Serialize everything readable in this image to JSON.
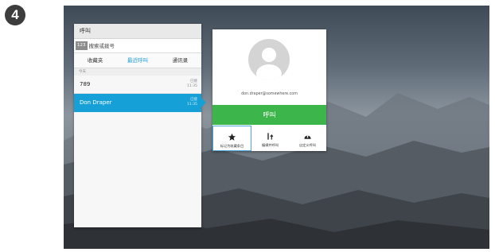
{
  "step": {
    "number": "4"
  },
  "call_panel": {
    "title": "呼叫",
    "keypad_label": "123",
    "search_placeholder": "搜索或拨号",
    "tabs": [
      {
        "label": "收藏夹"
      },
      {
        "label": "最近呼叫",
        "active": true
      },
      {
        "label": "通讯录"
      }
    ],
    "section_label": "今天",
    "items": [
      {
        "name": "789",
        "status": "已接",
        "time": "11:35"
      },
      {
        "name": "Don Draper",
        "status": "已接",
        "time": "11:35",
        "selected": true
      }
    ]
  },
  "contact_card": {
    "email": "don.draper@somewhere.com",
    "call_button_label": "呼叫",
    "actions": [
      {
        "icon": "star-icon",
        "label": "标记为收藏条目",
        "focused": true
      },
      {
        "icon": "edit-and-call-icon",
        "label": "编辑并呼叫"
      },
      {
        "icon": "custom-ringtone-icon",
        "label": "自定义呼叫"
      }
    ]
  },
  "colors": {
    "accent_blue": "#15a0d7",
    "call_green": "#3cb64a",
    "badge_dark": "#3d3d3d"
  }
}
